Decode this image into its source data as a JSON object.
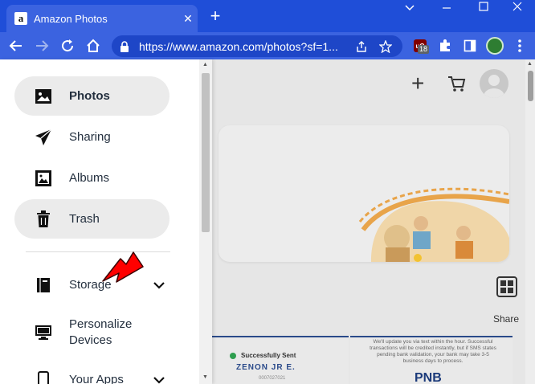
{
  "browser": {
    "tab_title": "Amazon Photos",
    "favicon_letter": "a",
    "url": "https://www.amazon.com/photos?sf=1...",
    "extension_badge": "18",
    "ublock_label": "uO"
  },
  "sidebar": {
    "items": [
      {
        "label": "Photos",
        "icon": "photo-icon"
      },
      {
        "label": "Sharing",
        "icon": "paper-plane-icon"
      },
      {
        "label": "Albums",
        "icon": "albums-icon"
      },
      {
        "label": "Trash",
        "icon": "trash-icon"
      },
      {
        "label": "Storage",
        "icon": "storage-icon"
      },
      {
        "label": "Personalize Devices",
        "line1": "Personalize",
        "line2": "Devices",
        "icon": "monitor-icon"
      },
      {
        "label": "Your Apps",
        "icon": "phone-icon"
      }
    ]
  },
  "main": {
    "share_label": "Share",
    "card1": {
      "status": "Successfully Sent",
      "name": "ZENON JR E.",
      "ref": "0007027021"
    },
    "card2": {
      "text": "We'll update you via text within the hour. Successful transactions will be credited instantly, but if SMS states pending bank validation, your bank may take 3-5 business days to process.",
      "logo": "PNB"
    }
  },
  "colors": {
    "chrome_titlebar": "#1f4ed8",
    "chrome_toolbar": "#3b63e0",
    "omnibox": "#1e46c7",
    "active_item_bg": "#ebebeb",
    "annotation_arrow": "#ff0000"
  }
}
